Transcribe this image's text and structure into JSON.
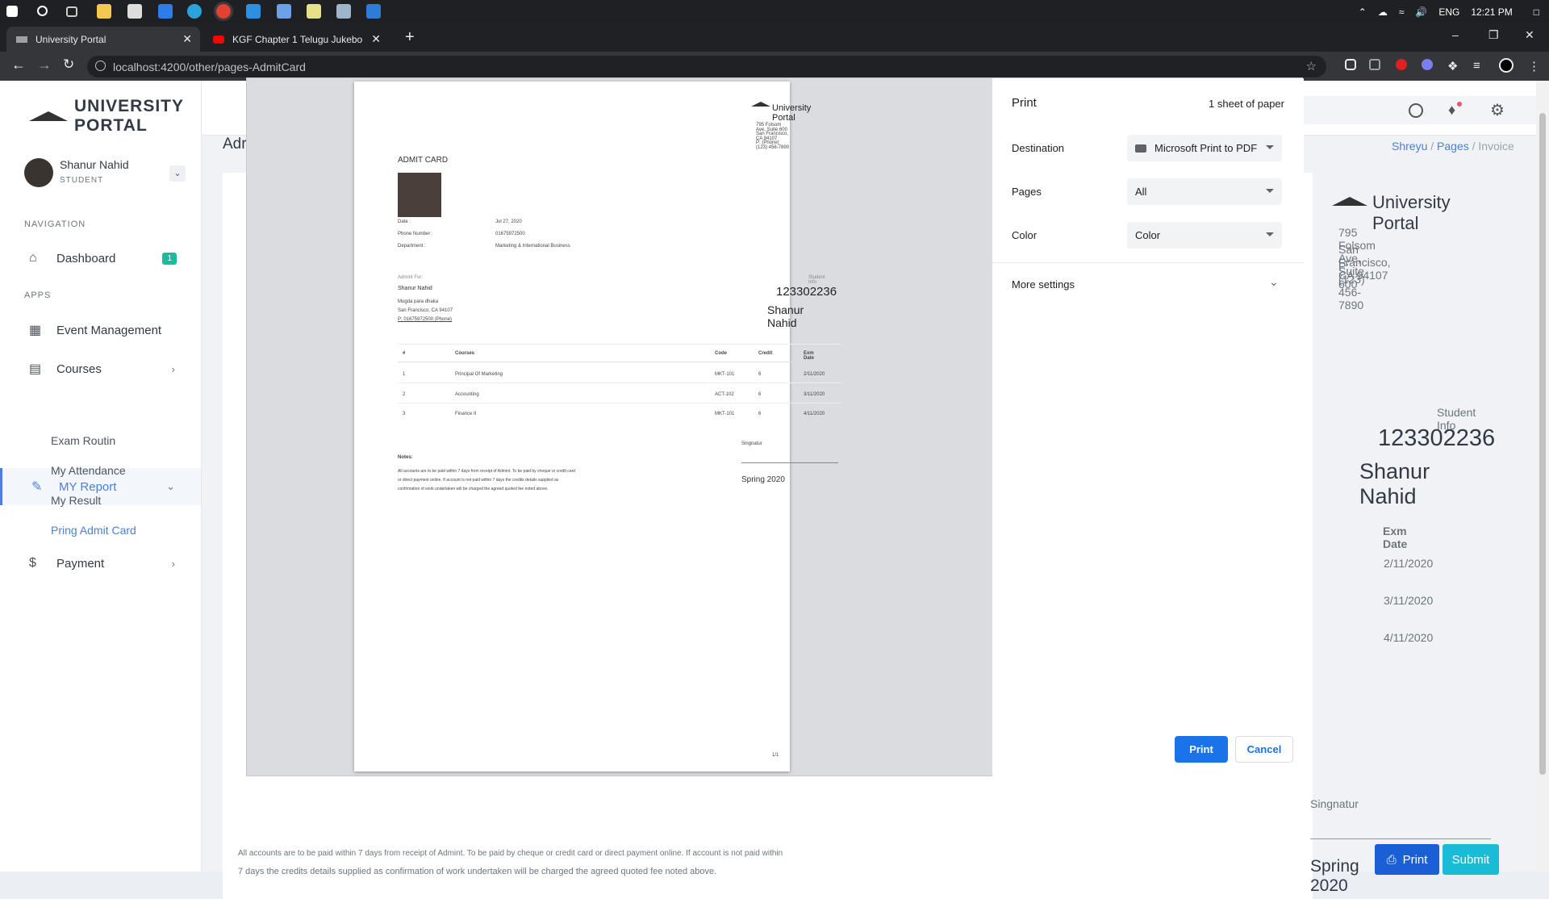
{
  "taskbar": {
    "lang": "ENG",
    "time": "12:21 PM"
  },
  "browser": {
    "tabs": [
      {
        "title": "University Portal"
      },
      {
        "title": "KGF Chapter 1 Telugu Jukebo"
      }
    ],
    "url": "localhost:4200/other/pages-AdmitCard"
  },
  "app": {
    "logo": "UNIVERSITY PORTAL",
    "user": {
      "name": "Shanur Nahid",
      "role": "STUDENT"
    },
    "nav_label": "NAVIGATION",
    "apps_label": "APPS",
    "nav": {
      "dashboard": "Dashboard",
      "dashboard_badge": "1",
      "event": "Event Management",
      "courses": "Courses",
      "report": "MY Report",
      "payment": "Payment"
    },
    "submenu": [
      "Exam Routin",
      "My Attendance",
      "My Result",
      "Pring Admit Card"
    ],
    "breadcrumb": [
      "Shreyu",
      "Pages",
      "Invoice"
    ],
    "page_title_partial": "Adr"
  },
  "invoice_bg": {
    "brand": "University Portal",
    "address": [
      "795 Folsom Ave, Suite 600",
      "San Francisco, CA 94107",
      "P: (123) 456-7890"
    ],
    "student_info_label": "Student Info",
    "student_id": "123302236",
    "student_name": "Shanur Nahid",
    "col_exm_date": "Exm Date",
    "dates": [
      "2/11/2020",
      "3/11/2020",
      "4/11/2020"
    ],
    "signature": "Singnatur",
    "semester": "Spring 2020",
    "notes_line1": "All accounts are to be paid within 7 days from receipt of Admint. To be paid by cheque or credit card or direct payment online. If account is not paid within",
    "notes_line2": "7 days the credits details supplied as confirmation of work undertaken will be charged the agreed quoted fee noted above.",
    "print_btn": "Print",
    "submit_btn": "Submit"
  },
  "preview": {
    "brand": "University Portal",
    "address": [
      "795 Folsom Ave, Suite 600",
      "San Francisco, CA 94107",
      "P: (Phone) (123) 456-7890"
    ],
    "title": "ADMIT CARD",
    "fields": [
      {
        "label": "Date :",
        "value": "Jul 27, 2020"
      },
      {
        "label": "Phone Number :",
        "value": "01675972500"
      },
      {
        "label": "Department :",
        "value": "Marketing & International Business"
      }
    ],
    "admit_for_label": "Admint For:",
    "admit_name": "Shanur Nahid",
    "admit_address": [
      "Mugda para dhaka",
      "San Francisco, CA 94107",
      "P: 01675972500 (Phone)"
    ],
    "student_info_label": "Student Info",
    "student_id": "123302236",
    "student_name": "Shanur Nahid",
    "table_headers": [
      "#",
      "Courses",
      "Code",
      "Credit",
      "Exm Date"
    ],
    "rows": [
      [
        "1",
        "Principal Of Marketing",
        "MKT-101",
        "6",
        "2/11/2020"
      ],
      [
        "2",
        "Accounting",
        "ACT-102",
        "6",
        "3/11/2020"
      ],
      [
        "3",
        "Finance II",
        "MKT-101",
        "6",
        "4/11/2020"
      ]
    ],
    "notes_title": "Notes:",
    "notes": [
      "All accounts are to be paid within 7 days from receipt of Admint. To be paid by cheque or credit card",
      "or direct payment online. If account is not paid within 7 days the credits details supplied as",
      "confirmation of work undertaken will be charged the agreed quoted fee noted above."
    ],
    "signature": "Singnatur",
    "semester": "Spring 2020",
    "page_num": "1/1"
  },
  "print_dialog": {
    "title": "Print",
    "sheets": "1 sheet of paper",
    "destination_label": "Destination",
    "destination_value": "Microsoft Print to PDF",
    "pages_label": "Pages",
    "pages_value": "All",
    "color_label": "Color",
    "color_value": "Color",
    "more_settings": "More settings",
    "print_btn": "Print",
    "cancel_btn": "Cancel"
  },
  "colors": {
    "primary": "#4a81d4",
    "chrome_dark": "#202124",
    "print_blue": "#1a73e8"
  }
}
